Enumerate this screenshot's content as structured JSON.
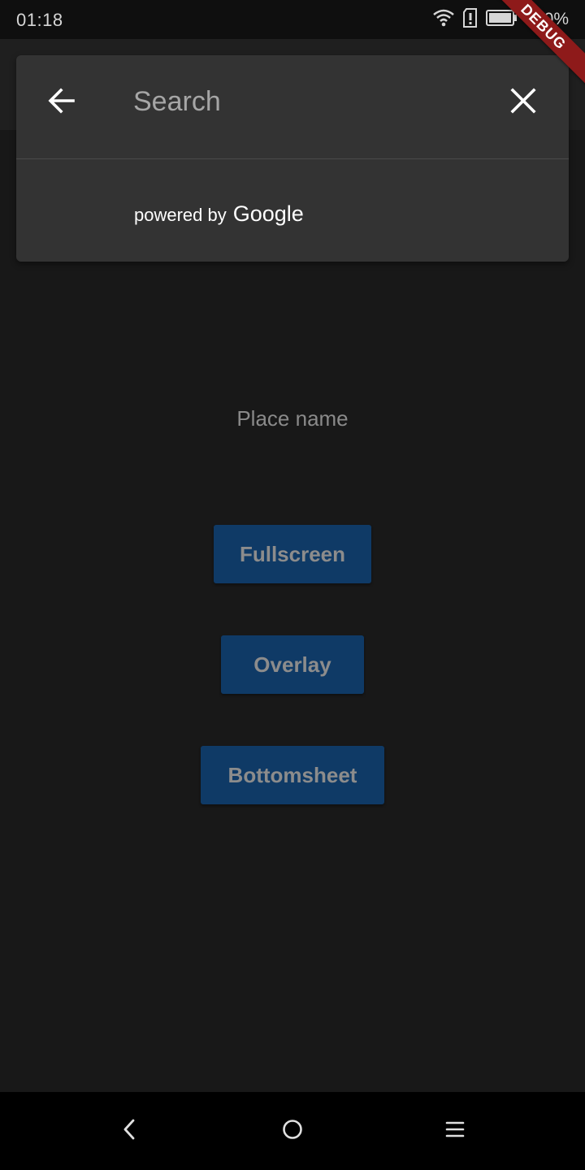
{
  "status_bar": {
    "time": "01:18",
    "battery": "100%",
    "icons": [
      "wifi-icon",
      "sim-alert-icon",
      "battery-icon"
    ]
  },
  "debug_banner": "DEBUG",
  "search": {
    "placeholder": "Search",
    "value": "",
    "back_icon": "arrow-left-icon",
    "clear_icon": "close-icon",
    "attribution_prefix": "powered by",
    "attribution_brand": "Google"
  },
  "main": {
    "place_name": "Place name",
    "buttons": {
      "fullscreen": "Fullscreen",
      "overlay": "Overlay",
      "bottomsheet": "Bottomsheet"
    }
  },
  "nav_bar": {
    "icons": [
      "chevron-left-icon",
      "circle-home-icon",
      "menu-icon"
    ]
  },
  "colors": {
    "background": "#181818",
    "card": "#333333",
    "button": "#0f3a66",
    "button_text": "#8c8c8c",
    "debug": "#8e1a1a"
  }
}
